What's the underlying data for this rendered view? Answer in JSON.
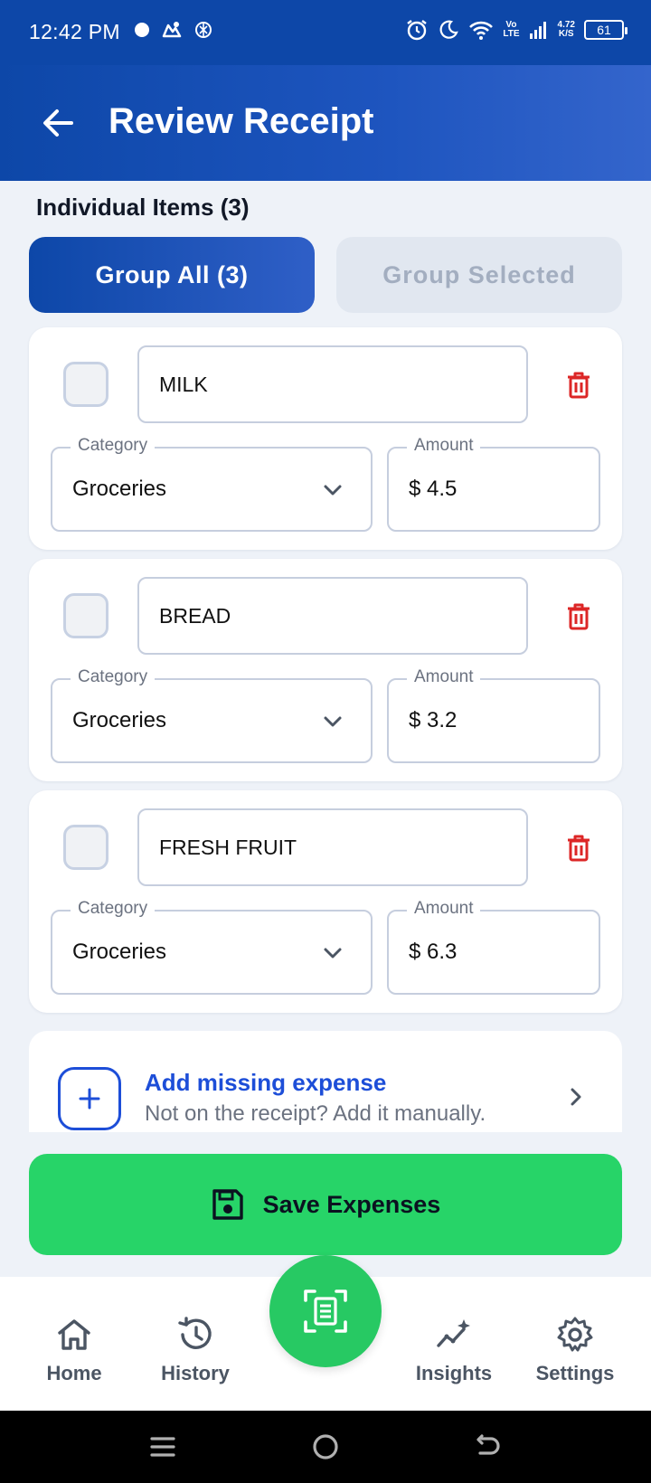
{
  "status_bar": {
    "time": "12:42 PM",
    "net_speed_value": "4.72",
    "net_speed_unit": "K/S",
    "volte_top": "Vo",
    "volte_bottom": "LTE",
    "battery": "61"
  },
  "header": {
    "title": "Review Receipt"
  },
  "items_section": {
    "title": "Individual Items (3)",
    "group_all_label": "Group All (3)",
    "group_selected_label": "Group Selected"
  },
  "field_labels": {
    "category": "Category",
    "amount": "Amount"
  },
  "items": [
    {
      "name": "MILK",
      "category": "Groceries",
      "amount": "$ 4.5"
    },
    {
      "name": "BREAD",
      "category": "Groceries",
      "amount": "$ 3.2"
    },
    {
      "name": "FRESH FRUIT",
      "category": "Groceries",
      "amount": "$ 6.3"
    }
  ],
  "add_missing": {
    "title": "Add missing expense",
    "subtitle": "Not on the receipt? Add it manually."
  },
  "save_button": {
    "label": "Save Expenses"
  },
  "bottom_nav": {
    "items": [
      {
        "label": "Home",
        "icon": "home-icon"
      },
      {
        "label": "History",
        "icon": "history-icon"
      },
      {
        "label": "Insights",
        "icon": "insights-icon"
      },
      {
        "label": "Settings",
        "icon": "gear-icon"
      }
    ],
    "fab_icon": "scan-receipt-icon"
  },
  "colors": {
    "primary": "#0d47a8",
    "accent_green": "#27d468",
    "delete_red": "#dc2626",
    "link_blue": "#1d4ed8"
  }
}
